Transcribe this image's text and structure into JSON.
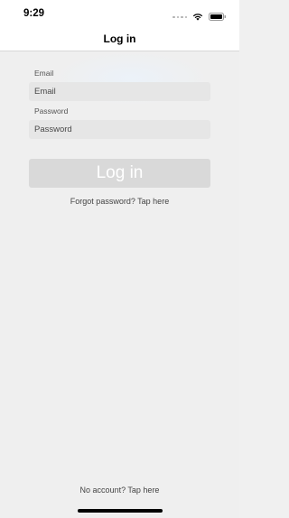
{
  "status_bar": {
    "time": "9:29",
    "icons": [
      "signal-dots-icon",
      "wifi-icon",
      "battery-icon"
    ]
  },
  "nav": {
    "title": "Log in"
  },
  "form": {
    "email_label": "Email",
    "email_placeholder": "Email",
    "password_label": "Password",
    "password_placeholder": "Password",
    "login_button": "Log in",
    "forgot_link": "Forgot password? Tap here"
  },
  "footer": {
    "signup_link": "No account? Tap here"
  },
  "colors": {
    "background": "#efefef",
    "input_bg": "#e6e6e6",
    "button_bg": "#d9d9d9",
    "button_text": "#ffffff"
  }
}
